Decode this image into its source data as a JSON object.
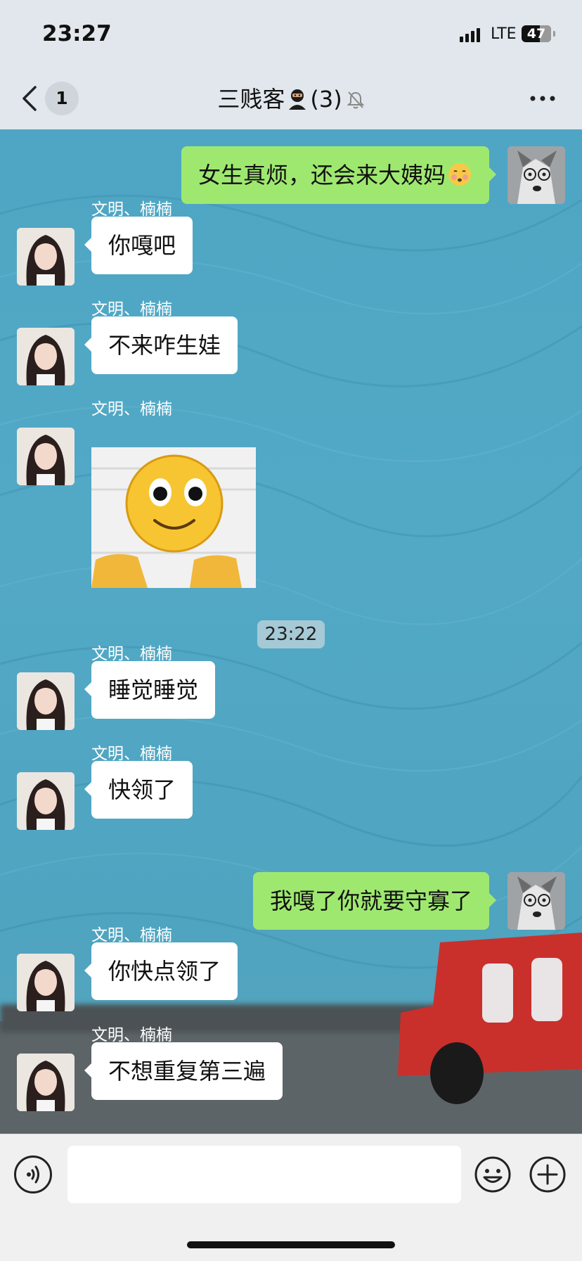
{
  "status": {
    "time": "23:27",
    "network": "LTE",
    "battery": "47"
  },
  "nav": {
    "back_count": "1",
    "title": "三贱客",
    "title_suffix": "(3)"
  },
  "messages": [
    {
      "side": "right",
      "text": "女生真烦，还会来大姨妈"
    },
    {
      "side": "left",
      "sender": "文明、楠楠",
      "text": "你嘎吧"
    },
    {
      "side": "left",
      "sender": "文明、楠楠",
      "text": "不来咋生娃"
    },
    {
      "side": "left",
      "sender": "文明、楠楠",
      "sticker": "smiley-sticker"
    },
    {
      "side": "left",
      "sender": "文明、楠楠",
      "text": "睡觉睡觉"
    },
    {
      "side": "left",
      "sender": "文明、楠楠",
      "text": "快领了"
    },
    {
      "side": "right",
      "text": "我嘎了你就要守寡了"
    },
    {
      "side": "left",
      "sender": "文明、楠楠",
      "text": "你快点领了"
    },
    {
      "side": "left",
      "sender": "文明、楠楠",
      "text": "不想重复第三遍"
    }
  ],
  "timestamp_divider": "23:22",
  "input": {
    "placeholder": ""
  },
  "icons": {
    "back": "chevron-left-icon",
    "more": "more-icon",
    "mute": "bell-off-icon",
    "voice": "voice-icon",
    "emoji": "emoji-icon",
    "plus": "plus-icon"
  },
  "colors": {
    "outgoing_bubble": "#9fe870",
    "incoming_bubble": "#ffffff",
    "chat_background": "#4ea6c4"
  }
}
